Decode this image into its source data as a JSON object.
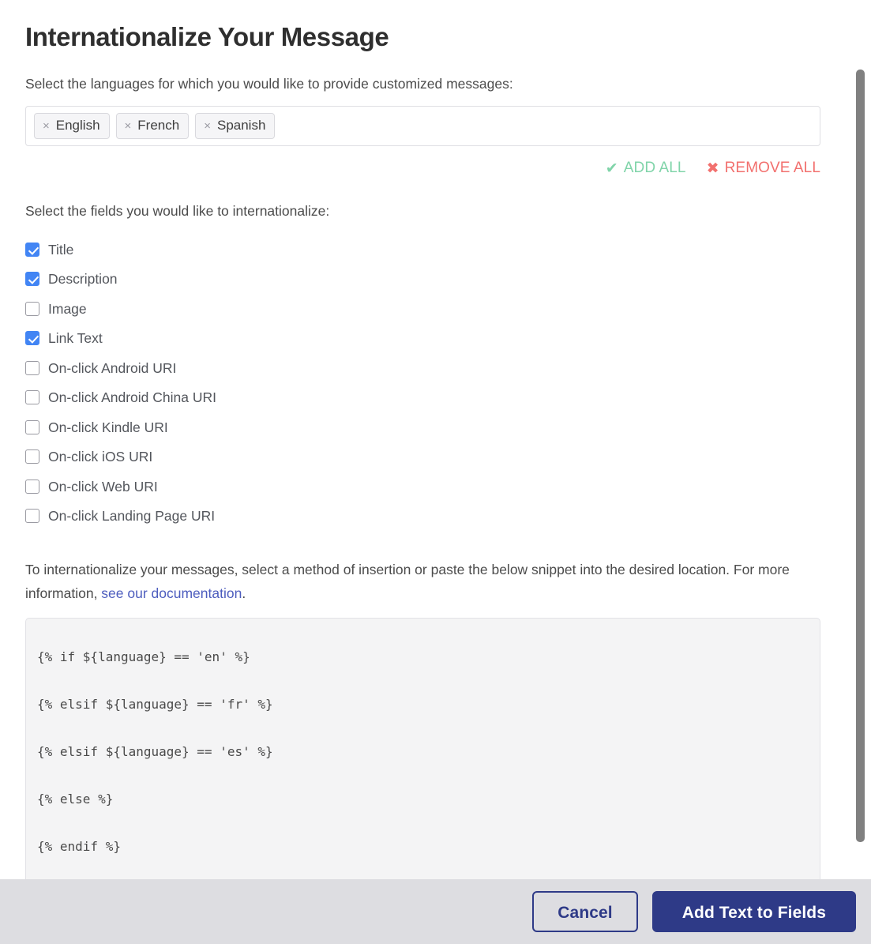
{
  "dialog": {
    "title": "Internationalize Your Message",
    "languages_prompt": "Select the languages for which you would like to provide customized messages:",
    "fields_prompt": "Select the fields you would like to internationalize:"
  },
  "language_select": {
    "chips": [
      {
        "remove_glyph": "×",
        "label": "English"
      },
      {
        "remove_glyph": "×",
        "label": "French"
      },
      {
        "remove_glyph": "×",
        "label": "Spanish"
      }
    ]
  },
  "bulk_actions": {
    "add_all": {
      "glyph": "✔",
      "label": "ADD ALL",
      "color": "#80d4a9"
    },
    "remove_all": {
      "glyph": "✖",
      "label": "REMOVE ALL",
      "color": "#f2706e"
    }
  },
  "fields": [
    {
      "label": "Title",
      "checked": true
    },
    {
      "label": "Description",
      "checked": true
    },
    {
      "label": "Image",
      "checked": false
    },
    {
      "label": "Link Text",
      "checked": true
    },
    {
      "label": "On-click Android URI",
      "checked": false
    },
    {
      "label": "On-click Android China URI",
      "checked": false
    },
    {
      "label": "On-click Kindle URI",
      "checked": false
    },
    {
      "label": "On-click iOS URI",
      "checked": false
    },
    {
      "label": "On-click Web URI",
      "checked": false
    },
    {
      "label": "On-click Landing Page URI",
      "checked": false
    }
  ],
  "instructions": {
    "text_before_link": "To internationalize your messages, select a method of insertion or paste the below snippet into the desired location. For more information, ",
    "link_text": "see our documentation",
    "text_after_link": "."
  },
  "code_snippet": {
    "lines": [
      "{% if ${language} == 'en' %}",
      "{% elsif ${language} == 'fr' %}",
      "{% elsif ${language} == 'es' %}",
      "{% else %}",
      "{% endif %}"
    ]
  },
  "footer": {
    "cancel_label": "Cancel",
    "submit_label": "Add Text to Fields",
    "primary_color": "#2e3a87",
    "background_color": "#dddde1"
  },
  "scrollbar": {
    "orientation": "vertical",
    "thumb_color": "#808080"
  }
}
